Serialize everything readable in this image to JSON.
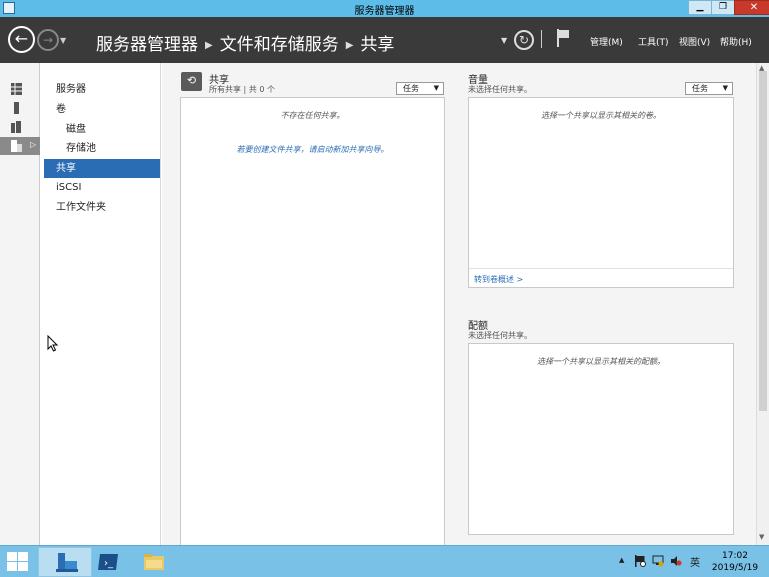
{
  "window": {
    "title": "服务器管理器",
    "minimize_label": "▁",
    "restore_label": "❐",
    "close_label": "✕"
  },
  "header": {
    "back_glyph": "←",
    "forward_glyph": "→",
    "breadcrumb": [
      "服务器管理器",
      "文件和存储服务",
      "共享"
    ],
    "refresh_glyph": "↻",
    "menus": {
      "manage": "管理(M)",
      "tools": "工具(T)",
      "view": "视图(V)",
      "help": "帮助(H)"
    }
  },
  "rail": {
    "items": [
      "dashboard-icon",
      "local-server-icon",
      "all-servers-icon",
      "file-storage-icon"
    ],
    "selected_index": 3
  },
  "tree": {
    "items": [
      {
        "label": "服务器",
        "child": false
      },
      {
        "label": "卷",
        "child": false
      },
      {
        "label": "磁盘",
        "child": true
      },
      {
        "label": "存储池",
        "child": true
      },
      {
        "label": "共享",
        "child": false,
        "selected": true
      },
      {
        "label": "iSCSI",
        "child": false
      },
      {
        "label": "工作文件夹",
        "child": false
      }
    ]
  },
  "shares": {
    "title": "共享",
    "subtitle": "所有共享 | 共 0 个",
    "tasks_label": "任务",
    "empty_message": "不存在任何共享。",
    "create_link": "若要创建文件共享，请启动新加共享向导。"
  },
  "volume": {
    "title": "音量",
    "subtitle": "未选择任何共享。",
    "tasks_label": "任务",
    "message": "选择一个共享以显示其相关的卷。",
    "goto_link": "转到卷概述 >"
  },
  "quota": {
    "title": "配额",
    "subtitle": "未选择任何共享。",
    "message": "选择一个共享以显示其相关的配额。"
  },
  "taskbar": {
    "time": "17:02",
    "date": "2019/5/19",
    "ime": "英",
    "tray_up": "▲"
  },
  "colors": {
    "titlebar": "#5dbde8",
    "header": "#3a3a3a",
    "selection": "#2a6db5",
    "taskbar": "#79c1e6"
  }
}
